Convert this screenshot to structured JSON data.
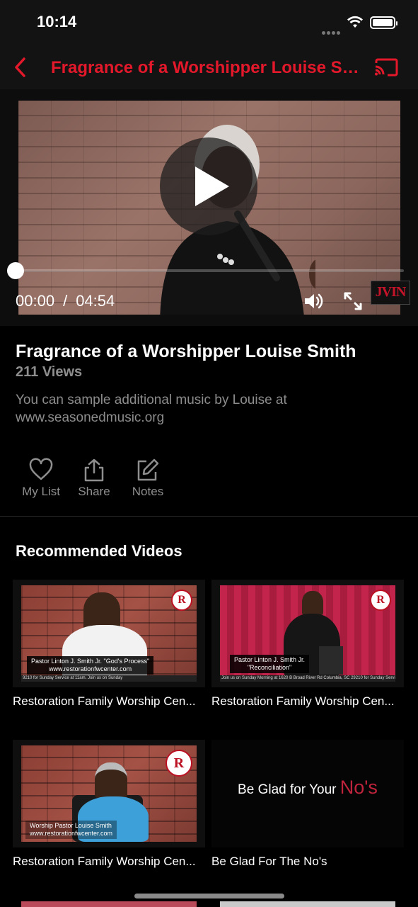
{
  "status_bar": {
    "time": "10:14"
  },
  "nav": {
    "title": "Fragrance of a Worshipper Louise Sm..."
  },
  "player": {
    "current_time": "00:00",
    "separator": "/",
    "duration": "04:54",
    "progress_fraction": 0,
    "logo_text": "JVIN"
  },
  "video": {
    "title": "Fragrance of a Worshipper Louise Smith",
    "views": "211 Views",
    "description": "You can sample additional music by Louise at www.seasonedmusic.org"
  },
  "actions": [
    {
      "label": "My List",
      "icon": "heart-icon"
    },
    {
      "label": "Share",
      "icon": "share-icon"
    },
    {
      "label": "Notes",
      "icon": "edit-icon"
    }
  ],
  "recommended": {
    "heading": "Recommended Videos",
    "items": [
      {
        "title": "Restoration Family Worship Cen...",
        "badge": "R",
        "lower_third_line1": "Pastor Linton J. Smith Jr. \"God's Process\"",
        "lower_third_line2": "www.restorationfwcenter.com",
        "ticker": "9210 for Sunday Service at 11am.            Join us on Sunday"
      },
      {
        "title": "Restoration Family Worship Cen...",
        "badge": "R",
        "lower_third_line1": "Pastor Linton J. Smith Jr.",
        "lower_third_line2": "\"Reconciliation\"",
        "ticker": "Join us on Sunday Morning at 1620 B Broad River Rd Columbia, SC 29210 for Sunday Service at 11am."
      },
      {
        "title": "Restoration Family Worship Cen...",
        "badge": "R",
        "lower_third_line1": "Worship Pastor Louise Smith",
        "lower_third_line2": "www.restorationfwcenter.com"
      },
      {
        "title": "Be Glad For The No's",
        "thumb_text": "Be Glad for Your ",
        "thumb_accent": "No's"
      }
    ]
  },
  "colors": {
    "accent": "#e3192b",
    "background": "#000000",
    "bar": "#131313",
    "muted_text": "#8e8e8e"
  }
}
